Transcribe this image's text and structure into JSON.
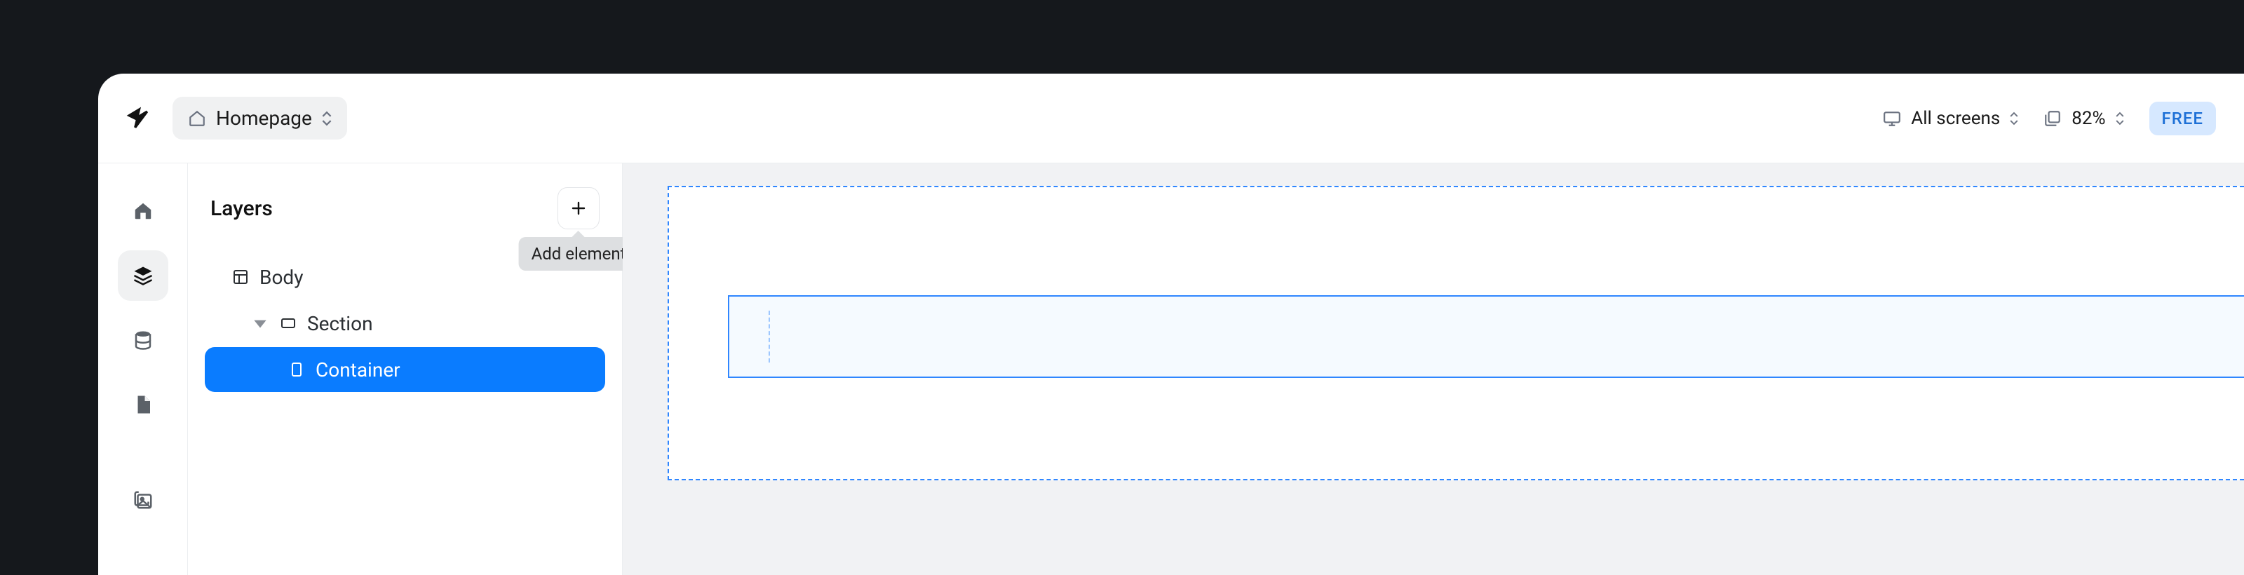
{
  "header": {
    "page_selector_label": "Homepage",
    "screens_label": "All screens",
    "zoom_label": "82%",
    "plan_badge": "FREE"
  },
  "layers": {
    "panel_title": "Layers",
    "add_tooltip": "Add element",
    "tree": {
      "body_label": "Body",
      "section_label": "Section",
      "container_label": "Container"
    }
  }
}
